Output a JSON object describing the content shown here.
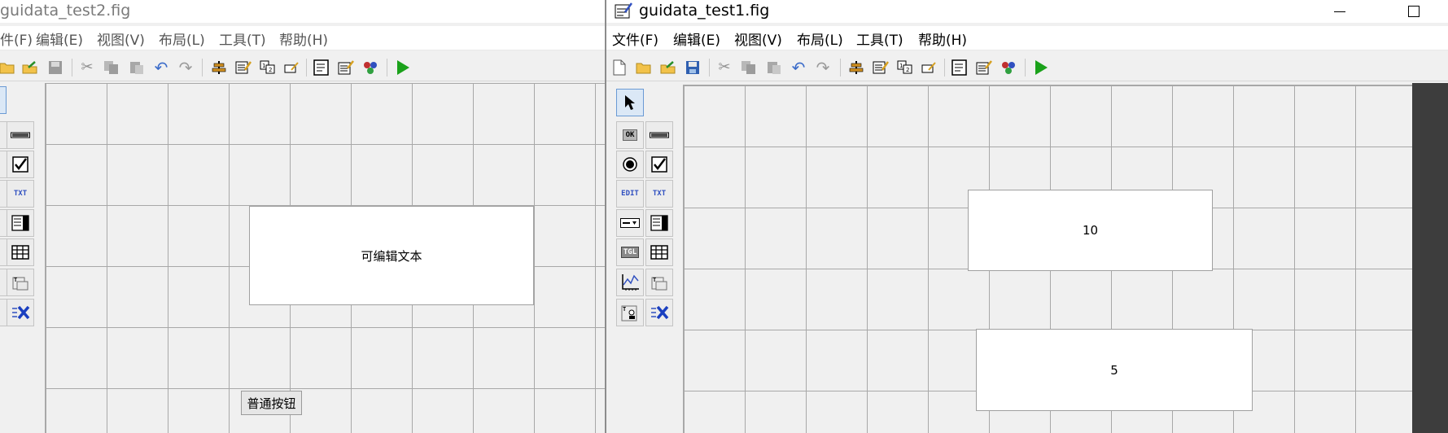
{
  "window2": {
    "title": "guidata_test2.fig",
    "menu": [
      {
        "name": "file",
        "label": "件(F)"
      },
      {
        "name": "edit",
        "label": "编辑(E)"
      },
      {
        "name": "view",
        "label": "视图(V)"
      },
      {
        "name": "layout",
        "label": "布局(L)"
      },
      {
        "name": "tools",
        "label": "工具(T)"
      },
      {
        "name": "help",
        "label": "帮助(H)"
      }
    ],
    "edit_text_value": "可编辑文本",
    "push_button_label": "普通按钮"
  },
  "window1": {
    "title": "guidata_test1.fig",
    "menu": [
      {
        "name": "file",
        "label": "文件(F)"
      },
      {
        "name": "edit",
        "label": "编辑(E)"
      },
      {
        "name": "view",
        "label": "视图(V)"
      },
      {
        "name": "layout",
        "label": "布局(L)"
      },
      {
        "name": "tools",
        "label": "工具(T)"
      },
      {
        "name": "help",
        "label": "帮助(H)"
      }
    ],
    "edit_box_1_value": "10",
    "edit_box_2_value": "5"
  },
  "palette_labels": {
    "pushbutton": "OK",
    "edit": "EDIT",
    "text": "TXT",
    "toggle": "TGL"
  },
  "colors": {
    "run_green": "#1aa11a",
    "grid_line": "#a8a8a8",
    "canvas_bg": "#f0f0f0"
  }
}
